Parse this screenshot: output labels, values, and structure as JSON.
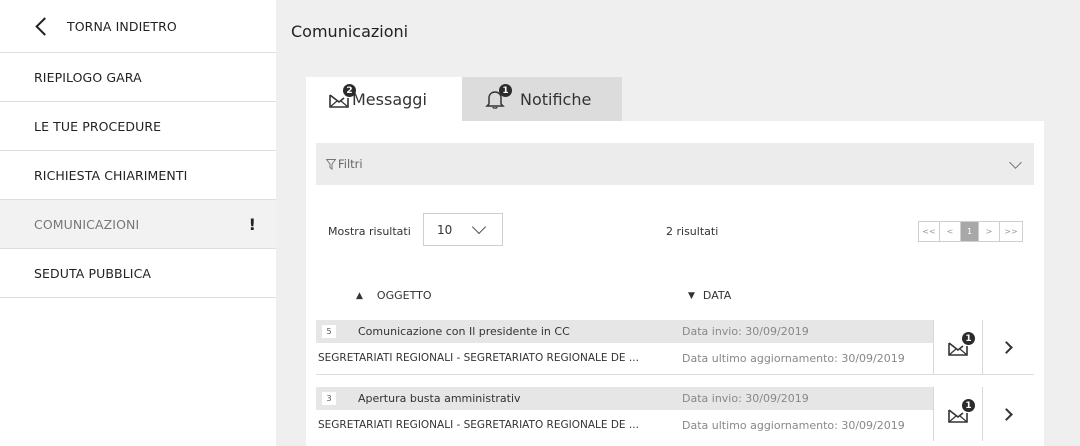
{
  "sidebar": {
    "back_label": "TORNA INDIETRO",
    "items": [
      {
        "label": "RIEPILOGO GARA"
      },
      {
        "label": "LE TUE PROCEDURE"
      },
      {
        "label": "RICHIESTA CHIARIMENTI"
      },
      {
        "label": "COMUNICAZIONI",
        "alert": "!"
      },
      {
        "label": "SEDUTA PUBBLICA"
      }
    ]
  },
  "page_title": "Comunicazioni",
  "tabs": [
    {
      "label": "Messaggi",
      "badge": "2",
      "icon": "envelope-icon"
    },
    {
      "label": "Notifiche",
      "badge": "1",
      "icon": "bell-icon"
    }
  ],
  "filters": {
    "label": "Filtri"
  },
  "results": {
    "show_label": "Mostra risultati",
    "page_size": "10",
    "count_text": "2 risultati"
  },
  "pager": {
    "first": "<<",
    "prev": "<",
    "current": "1",
    "next": ">",
    "last": ">>"
  },
  "columns": {
    "subject": "OGGETTO",
    "date": "DATA"
  },
  "rows": [
    {
      "num": "5",
      "subject": "Comunicazione con Il presidente in CC",
      "sent": "Data invio: 30/09/2019",
      "org": "SEGRETARIATI REGIONALI - SEGRETARIATO REGIONALE DE ...",
      "updated": "Data ultimo aggiornamento: 30/09/2019",
      "badge": "1"
    },
    {
      "num": "3",
      "subject": "Apertura busta amministrativ",
      "sent": "Data invio: 30/09/2019",
      "org": "SEGRETARIATI REGIONALI - SEGRETARIATO REGIONALE DE ...",
      "updated": "Data ultimo aggiornamento: 30/09/2019",
      "badge": "1"
    }
  ]
}
